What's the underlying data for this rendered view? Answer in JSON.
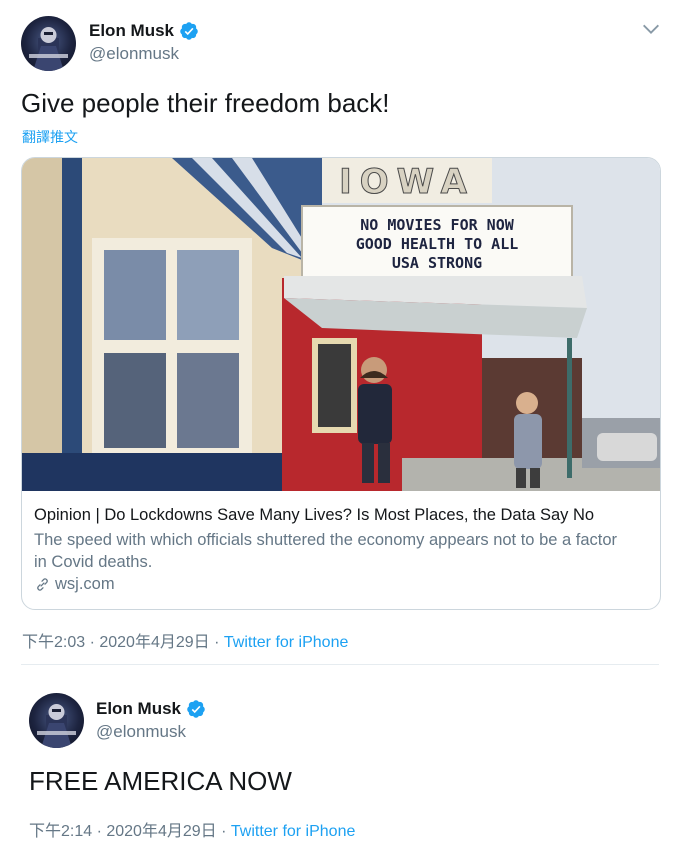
{
  "tweet1": {
    "name": "Elon Musk",
    "handle": "@elonmusk",
    "text": "Give people their freedom back!",
    "translate_label": "翻譯推文",
    "card": {
      "marquee_sign": "IOWA",
      "marquee_lines": [
        "NO MOVIES FOR NOW",
        "GOOD HEALTH TO ALL",
        "USA STRONG"
      ],
      "title": "Opinion | Do Lockdowns Save Many Lives? Is Most Places, the Data Say No",
      "description": "The speed with which officials shuttered the economy appears not to be a factor in Covid deaths.",
      "domain": "wsj.com"
    },
    "time": "下午2:03 · 2020年4月29日 · ",
    "source": "Twitter for iPhone"
  },
  "tweet2": {
    "name": "Elon Musk",
    "handle": "@elonmusk",
    "text": "FREE AMERICA NOW",
    "time": "下午2:14 · 2020年4月29日 · ",
    "source": "Twitter for iPhone"
  },
  "colors": {
    "accent": "#1da1f2",
    "secondary_text": "#657786",
    "border": "#ccd6dd"
  },
  "icons": [
    "verified-badge-icon",
    "chevron-down-icon",
    "link-icon"
  ]
}
